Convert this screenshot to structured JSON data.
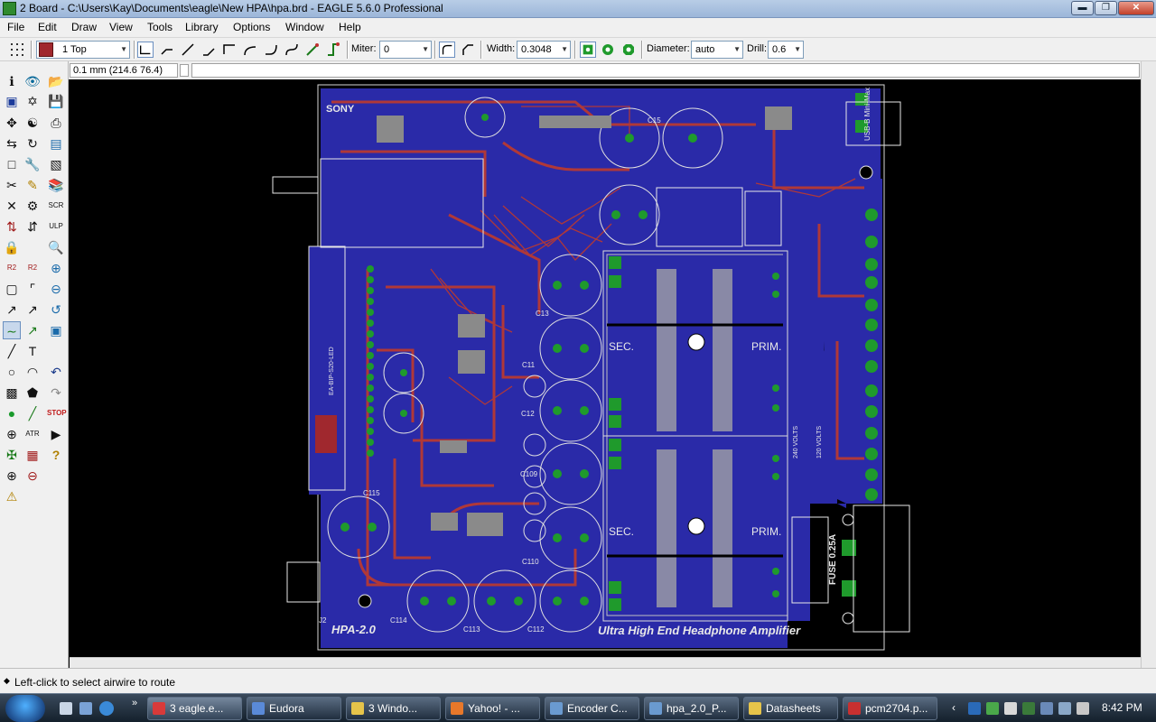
{
  "window": {
    "title": "2 Board - C:\\Users\\Kay\\Documents\\eagle\\New HPA\\hpa.brd - EAGLE 5.6.0 Professional"
  },
  "menu": [
    "File",
    "Edit",
    "Draw",
    "View",
    "Tools",
    "Library",
    "Options",
    "Window",
    "Help"
  ],
  "toolbar": {
    "layer": "1 Top",
    "miter_label": "Miter:",
    "miter_value": "0",
    "width_label": "Width:",
    "width_value": "0.3048",
    "diameter_label": "Diameter:",
    "diameter_value": "auto",
    "drill_label": "Drill:",
    "drill_value": "0.6"
  },
  "command": {
    "coordinates": "0.1 mm (214.6 76.4)"
  },
  "board": {
    "labels": {
      "brand": "SONY",
      "model": "HPA-2.0",
      "tagline": "Ultra High End Headphone Amplifier",
      "sec_top": "SEC.",
      "prim_top": "PRIM.",
      "sec_bottom": "SEC.",
      "prim_bottom": "PRIM.",
      "fuse": "FUSE 0.25A",
      "volts_a": "240 VOLTS",
      "volts_b": "120 VOLTS",
      "usb": "USB-B Mini-Max",
      "j2": "J2",
      "c113": "C113",
      "c112": "C112",
      "c114": "C114",
      "c115": "C115",
      "c110": "C110",
      "c109": "C109",
      "c15": "C15",
      "c13": "C13",
      "c12": "C12",
      "c11": "C11",
      "led": "EA-BIP-S20-LED"
    }
  },
  "status": {
    "text": "Left-click to select airwire to route"
  },
  "taskbar": {
    "items": [
      "3 eagle.e...",
      "Eudora",
      "3 Windo...",
      "Yahoo! - ...",
      "Encoder C...",
      "hpa_2.0_P...",
      "Datasheets",
      "pcm2704.p..."
    ],
    "clock": "8:42 PM"
  },
  "colors": {
    "board": "#2a2aa8",
    "trace": "#b03838",
    "pad": "#1f9a2c",
    "silk": "#e8e8e8"
  }
}
